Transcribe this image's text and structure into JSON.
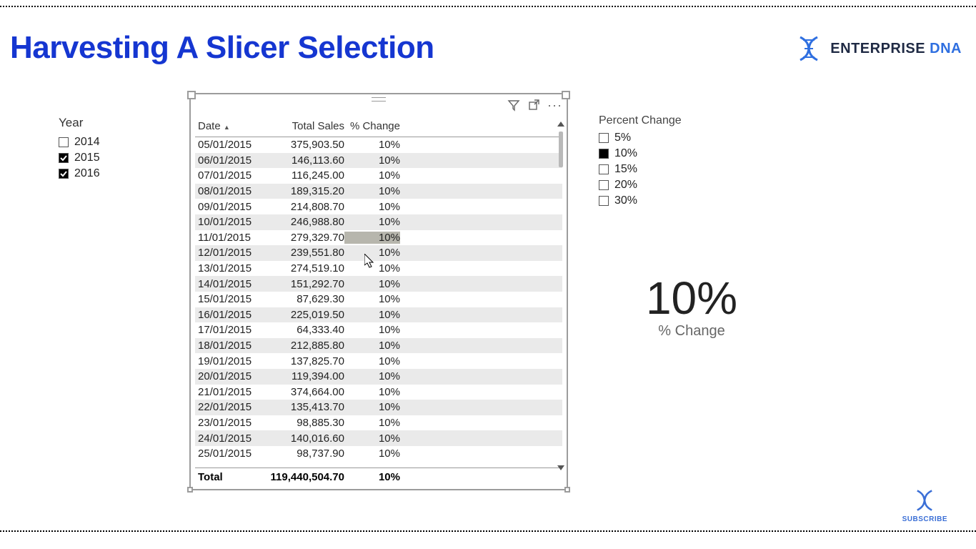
{
  "title": "Harvesting A Slicer Selection",
  "brand": {
    "name": "ENTERPRISE",
    "suffix": "DNA",
    "subscribe": "SUBSCRIBE"
  },
  "year_slicer": {
    "label": "Year",
    "items": [
      {
        "label": "2014",
        "checked": false
      },
      {
        "label": "2015",
        "checked": true
      },
      {
        "label": "2016",
        "checked": true
      }
    ]
  },
  "pct_slicer": {
    "label": "Percent Change",
    "items": [
      {
        "label": "5%",
        "checked": false
      },
      {
        "label": "10%",
        "checked": true
      },
      {
        "label": "15%",
        "checked": false
      },
      {
        "label": "20%",
        "checked": false
      },
      {
        "label": "30%",
        "checked": false
      }
    ]
  },
  "table": {
    "columns": {
      "date": "Date",
      "sales": "Total Sales",
      "change": "% Change"
    },
    "rows": [
      {
        "date": "05/01/2015",
        "sales": "375,903.50",
        "change": "10%"
      },
      {
        "date": "06/01/2015",
        "sales": "146,113.60",
        "change": "10%"
      },
      {
        "date": "07/01/2015",
        "sales": "116,245.00",
        "change": "10%"
      },
      {
        "date": "08/01/2015",
        "sales": "189,315.20",
        "change": "10%"
      },
      {
        "date": "09/01/2015",
        "sales": "214,808.70",
        "change": "10%"
      },
      {
        "date": "10/01/2015",
        "sales": "246,988.80",
        "change": "10%"
      },
      {
        "date": "11/01/2015",
        "sales": "279,329.70",
        "change": "10%",
        "highlight_change": true
      },
      {
        "date": "12/01/2015",
        "sales": "239,551.80",
        "change": "10%"
      },
      {
        "date": "13/01/2015",
        "sales": "274,519.10",
        "change": "10%"
      },
      {
        "date": "14/01/2015",
        "sales": "151,292.70",
        "change": "10%"
      },
      {
        "date": "15/01/2015",
        "sales": "87,629.30",
        "change": "10%"
      },
      {
        "date": "16/01/2015",
        "sales": "225,019.50",
        "change": "10%"
      },
      {
        "date": "17/01/2015",
        "sales": "64,333.40",
        "change": "10%"
      },
      {
        "date": "18/01/2015",
        "sales": "212,885.80",
        "change": "10%"
      },
      {
        "date": "19/01/2015",
        "sales": "137,825.70",
        "change": "10%"
      },
      {
        "date": "20/01/2015",
        "sales": "119,394.00",
        "change": "10%"
      },
      {
        "date": "21/01/2015",
        "sales": "374,664.00",
        "change": "10%"
      },
      {
        "date": "22/01/2015",
        "sales": "135,413.70",
        "change": "10%"
      },
      {
        "date": "23/01/2015",
        "sales": "98,885.30",
        "change": "10%"
      },
      {
        "date": "24/01/2015",
        "sales": "140,016.60",
        "change": "10%"
      },
      {
        "date": "25/01/2015",
        "sales": "98,737.90",
        "change": "10%"
      }
    ],
    "total": {
      "label": "Total",
      "sales": "119,440,504.70",
      "change": "10%"
    }
  },
  "card": {
    "value": "10%",
    "label": "% Change"
  }
}
